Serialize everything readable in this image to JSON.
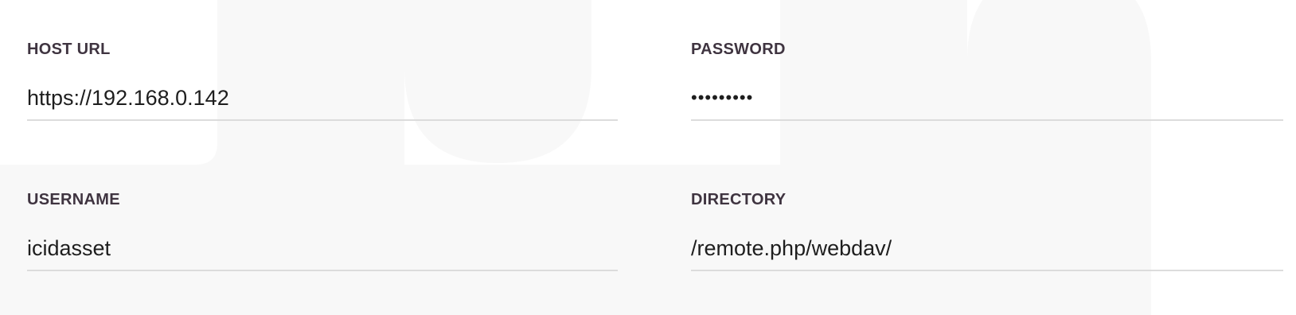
{
  "form": {
    "host_url": {
      "label": "HOST URL",
      "value": "https://192.168.0.142"
    },
    "password": {
      "label": "PASSWORD",
      "value": "•••••••••"
    },
    "username": {
      "label": "USERNAME",
      "value": "icidasset"
    },
    "directory": {
      "label": "DIRECTORY",
      "value": "/remote.php/webdav/"
    }
  },
  "colors": {
    "label": "#3f3440",
    "value": "#1e1e1e",
    "underline": "#dcdcdc",
    "background": "#ffffff",
    "decor": "#f8f8f8"
  }
}
